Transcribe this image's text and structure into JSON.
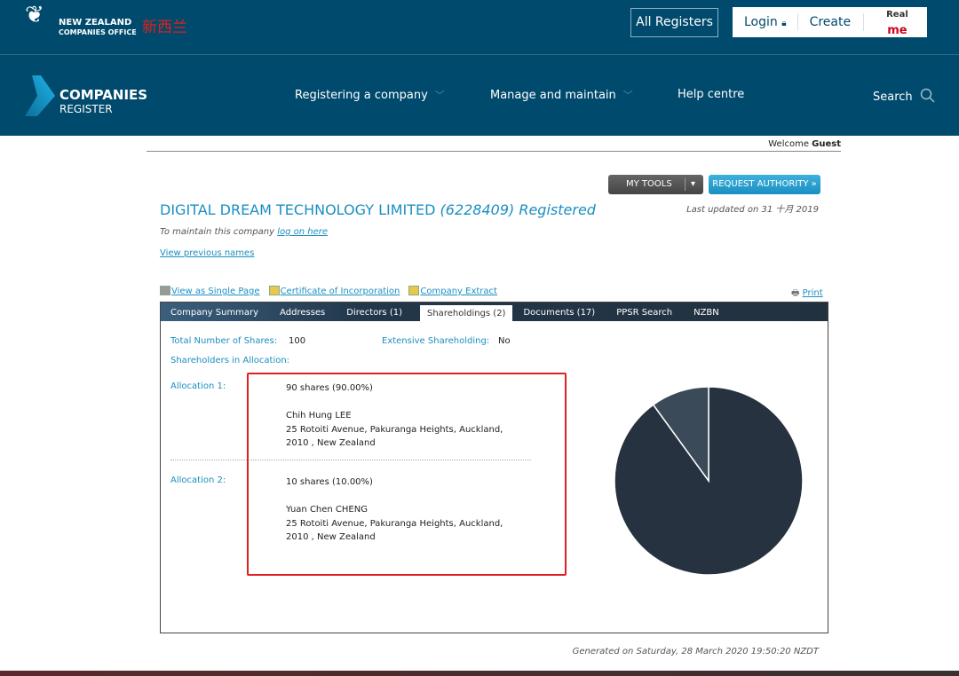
{
  "header": {
    "logo_line1": "NEW ZEALAND",
    "logo_line2": "COMPANIES OFFICE",
    "cn_label": "新西兰",
    "all_registers": "All Registers",
    "login": "Login",
    "create": "Create",
    "realme_1": "Real",
    "realme_2": "me"
  },
  "brand": {
    "line1": "COMPANIES",
    "line2": "REGISTER"
  },
  "nav": [
    {
      "label": "Registering a company"
    },
    {
      "label": "Manage and maintain"
    },
    {
      "label": "Help centre"
    },
    {
      "label": "Search"
    }
  ],
  "welcome": {
    "text": "Welcome ",
    "user": "Guest"
  },
  "tools": {
    "my_tools": "MY TOOLS",
    "request": "REQUEST AUTHORITY »"
  },
  "company": {
    "name": "DIGITAL DREAM TECHNOLOGY LIMITED",
    "number_status": "(6228409) Registered",
    "last_updated": "Last updated on 31 十月 2019",
    "maintain_text": "To maintain this company ",
    "maintain_link": "log on here",
    "previous_names": "View previous names"
  },
  "links": [
    "View as Single Page",
    "Certificate of Incorporation",
    "Company Extract"
  ],
  "print": "Print",
  "tabs": [
    "Company Summary",
    "Addresses",
    "Directors (1)",
    "Shareholdings (2)",
    "Documents (17)",
    "PPSR Search",
    "NZBN"
  ],
  "active_tab": "Shareholdings (2)",
  "shareholdings": {
    "total_label": "Total Number of Shares:",
    "total": "100",
    "extensive_label": "Extensive Shareholding:",
    "extensive": "No",
    "allocation_heading": "Shareholders in Allocation:",
    "allocations": [
      {
        "label": "Allocation 1:",
        "shares": "90 shares (90.00%)",
        "name": "Chih Hung LEE",
        "addr1": "25 Rotoiti Avenue, Pakuranga Heights, Auckland,",
        "addr2": "2010 , New Zealand",
        "percent": 90
      },
      {
        "label": "Allocation 2:",
        "shares": "10 shares (10.00%)",
        "name": "Yuan Chen CHENG",
        "addr1": "25 Rotoiti Avenue, Pakuranga Heights, Auckland,",
        "addr2": "2010 , New Zealand",
        "percent": 10
      }
    ]
  },
  "chart_data": {
    "type": "pie",
    "values": [
      90,
      10
    ],
    "colors": [
      "#26323f",
      "#3a4a58"
    ]
  },
  "footer": "Generated on Saturday, 28 March 2020 19:50:20 NZDT"
}
